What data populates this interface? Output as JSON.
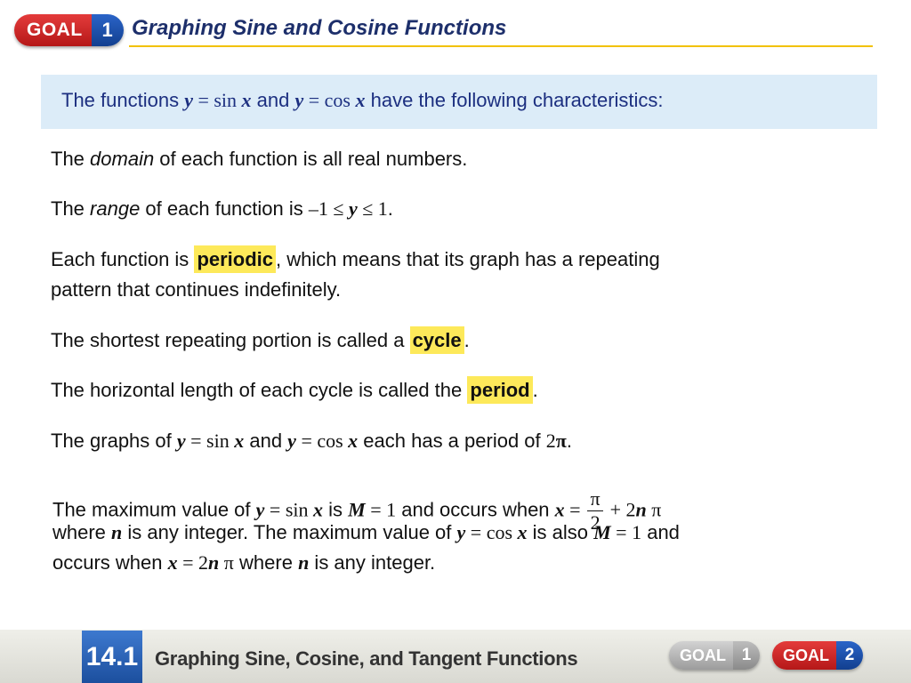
{
  "header": {
    "goal_word": "GOAL",
    "goal_number": "1",
    "title": "Graphing Sine and Cosine Functions"
  },
  "intro": {
    "prefix": "The functions ",
    "f1_y": "y",
    "f1_eq": " = sin ",
    "f1_x": "x",
    "and": " and ",
    "f2_y": "y",
    "f2_eq": " = cos ",
    "f2_x": "x",
    "suffix": " have the following characteristics:"
  },
  "domain_line": {
    "before": "The ",
    "term": "domain",
    "after": " of each function is all real numbers."
  },
  "range_line": {
    "before": "The ",
    "term": "range",
    "after": " of each function is ",
    "lower": "–1 ≤ ",
    "var": "y",
    "upper": " ≤ 1",
    "end": "."
  },
  "periodic_line": {
    "before": "Each function is ",
    "term": "periodic",
    "after": ", which means that its graph has a repeating",
    "line2": "pattern that continues indefinitely."
  },
  "cycle_line": {
    "before": "The shortest repeating portion is called a ",
    "term": "cycle",
    "after": "."
  },
  "period_line": {
    "before": "The horizontal length of each cycle is called the ",
    "term": "period",
    "after": "."
  },
  "graphs_line": {
    "before": "The graphs of ",
    "y1": "y",
    "eq1": " = sin ",
    "x1": "x",
    "and": " and ",
    "y2": "y",
    "eq2": " = cos ",
    "x2": "x",
    "mid": " each has a period of ",
    "two": "2",
    "pi": "π",
    "end": "."
  },
  "max_block": {
    "l1_before": "The maximum value of ",
    "l1_y": "y",
    "l1_eq": " = sin ",
    "l1_x": "x",
    "l1_is": " is ",
    "l1_M": "M",
    "l1_eq1": " = 1",
    "l1_occurs": " and occurs when ",
    "l1_x2": "x",
    "l1_eq2": " = ",
    "frac_num": "π",
    "frac_den": "2",
    "l1_plus": " + 2",
    "l1_n": "n",
    "l1_pi": " π",
    "l2_where": "where ",
    "l2_n": "n",
    "l2_mid": " is any integer.  The maximum value of ",
    "l2_y": "y",
    "l2_eq": " = cos ",
    "l2_x": "x",
    "l2_also": " is also ",
    "l2_M": "M",
    "l2_eq1": " = 1",
    "l2_and": " and",
    "l3_occurs": "occurs when ",
    "l3_x": "x",
    "l3_eq": " = 2",
    "l3_n": "n",
    "l3_pi": " π",
    "l3_where": " where ",
    "l3_n2": "n",
    "l3_end": " is any integer."
  },
  "footer": {
    "section_number": "14.1",
    "section_title": "Graphing Sine, Cosine, and Tangent Functions",
    "goal1_word": "GOAL",
    "goal1_num": "1",
    "goal2_word": "GOAL",
    "goal2_num": "2"
  },
  "colors": {
    "title_blue": "#1d2f6b",
    "intro_bg": "#dcecf8",
    "highlight_yellow": "#fde95a",
    "goal_red": "#c82020",
    "goal_blue": "#1a4fa8"
  }
}
